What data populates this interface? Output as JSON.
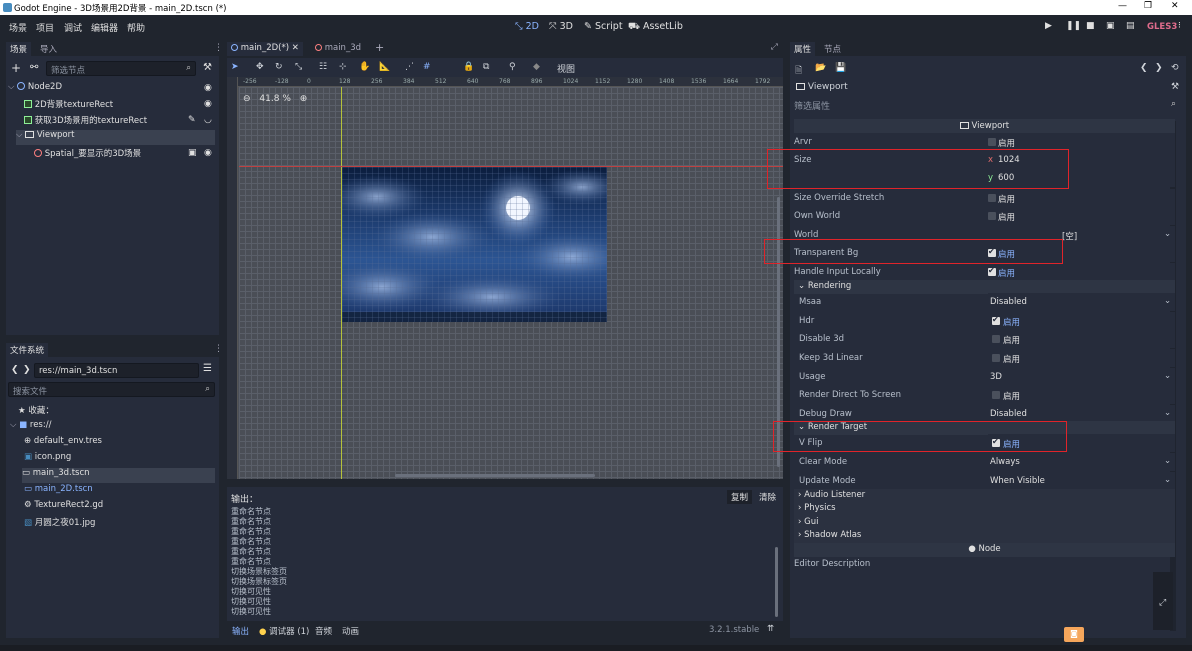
{
  "window": {
    "title": "Godot Engine - 3D场景用2D背景 - main_2D.tscn (*)"
  },
  "menu": {
    "items": [
      "场景",
      "项目",
      "调试",
      "编辑器",
      "帮助"
    ]
  },
  "workspaces": {
    "w2d": "2D",
    "w3d": "3D",
    "script": "Script",
    "assetlib": "AssetLib"
  },
  "renderer": "GLES3",
  "scene_dock": {
    "tabs": [
      "场景",
      "导入"
    ],
    "filter_placeholder": "筛选节点",
    "nodes": [
      {
        "label": "Node2D"
      },
      {
        "label": "2D背景textureRect"
      },
      {
        "label": "获取3D场景用的textureRect"
      },
      {
        "label": "Viewport"
      },
      {
        "label": "Spatial_要显示的3D场景"
      }
    ]
  },
  "fs_dock": {
    "tab": "文件系统",
    "path": "res://main_3d.tscn",
    "search_placeholder": "搜索文件",
    "favorites": "收藏：",
    "root": "res://",
    "files": [
      "default_env.tres",
      "icon.png",
      "main_3d.tscn",
      "main_2D.tscn",
      "TextureRect2.gd",
      "月圆之夜01.jpg"
    ]
  },
  "editor_tabs": [
    "main_2D(*)",
    "main_3d"
  ],
  "toolbar": {
    "view": "视图"
  },
  "zoom": "41.8 %",
  "ruler_labels": [
    "-256",
    "-128",
    "0",
    "128",
    "256",
    "384",
    "512",
    "640",
    "768",
    "896",
    "1024",
    "1152",
    "1280",
    "1408",
    "1536",
    "1664",
    "1792",
    "1920"
  ],
  "output": {
    "title": "输出：",
    "copy": "复制",
    "clear": "清除",
    "lines": [
      "重命名节点",
      "重命名节点",
      "重命名节点",
      "重命名节点",
      "重命名节点",
      "重命名节点",
      "切换场景标签页",
      "切换场景标签页",
      "切换可见性",
      "切换可见性",
      "切换可见性"
    ],
    "bottom_tabs": [
      "输出",
      "调试器 (1)",
      "音频",
      "动画"
    ],
    "version": "3.2.1.stable"
  },
  "inspector": {
    "tabs": [
      "属性",
      "节点"
    ],
    "object": "Viewport",
    "filter_placeholder": "筛选属性",
    "class_header": "Viewport",
    "enabled": "启用",
    "props": {
      "arvr": "Arvr",
      "size": "Size",
      "size_x_lbl": "x",
      "size_x": "1024",
      "size_y_lbl": "y",
      "size_y": "600",
      "size_override": "Size Override Stretch",
      "own_world": "Own World",
      "world": "World",
      "world_val": "[空]",
      "transparent_bg": "Transparent Bg",
      "handle_input": "Handle Input Locally",
      "rendering": "Rendering",
      "msaa": "Msaa",
      "msaa_val": "Disabled",
      "hdr": "Hdr",
      "disable_3d": "Disable 3d",
      "keep_3d_linear": "Keep 3d Linear",
      "usage": "Usage",
      "usage_val": "3D",
      "render_direct": "Render Direct To Screen",
      "debug_draw": "Debug Draw",
      "debug_draw_val": "Disabled",
      "render_target": "Render Target",
      "v_flip": "V Flip",
      "clear_mode": "Clear Mode",
      "clear_mode_val": "Always",
      "update_mode": "Update Mode",
      "update_mode_val": "When Visible",
      "audio_listener": "Audio Listener",
      "physics": "Physics",
      "gui": "Gui",
      "shadow_atlas": "Shadow Atlas",
      "node_section": "Node",
      "editor_desc": "Editor Description"
    }
  }
}
